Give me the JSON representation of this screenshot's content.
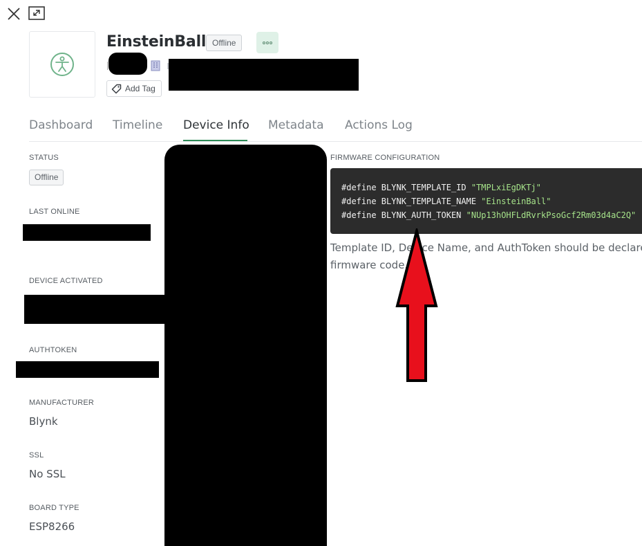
{
  "device": {
    "name": "EinsteinBall",
    "status": "Offline",
    "add_tag_label": "Add Tag"
  },
  "tabs": [
    {
      "label": "Dashboard",
      "active": false
    },
    {
      "label": "Timeline",
      "active": false
    },
    {
      "label": "Device Info",
      "active": true
    },
    {
      "label": "Metadata",
      "active": false
    },
    {
      "label": "Actions Log",
      "active": false
    }
  ],
  "info": {
    "status_label": "STATUS",
    "status_value": "Offline",
    "last_online_label": "LAST ONLINE",
    "device_activated_label": "DEVICE ACTIVATED",
    "authtoken_label": "AUTHTOKEN",
    "manufacturer_label": "MANUFACTURER",
    "manufacturer_value": "Blynk",
    "ssl_label": "SSL",
    "ssl_value": "No SSL",
    "board_type_label": "BOARD TYPE",
    "board_type_value": "ESP8266"
  },
  "firmware": {
    "section_label": "FIRMWARE CONFIGURATION",
    "lines": [
      {
        "keyword": "#define BLYNK_TEMPLATE_ID ",
        "value": "\"TMPLxiEgDKTj\""
      },
      {
        "keyword": "#define BLYNK_TEMPLATE_NAME ",
        "value": "\"EinsteinBall\""
      },
      {
        "keyword": "#define BLYNK_AUTH_TOKEN ",
        "value": "\"NUp13hOHFLdRvrkPsoGcf2Rm03d4aC2Q\""
      }
    ],
    "note_line1": "Template ID, Device Name, and AuthToken should be declared",
    "note_line2": "firmware code."
  },
  "icons": {
    "close": "close-icon",
    "expand": "expand-icon",
    "device": "accessibility-person-icon",
    "more": "more-dots-icon",
    "tag": "tag-icon",
    "org": "building-icon"
  },
  "colors": {
    "accent": "#2e8b57",
    "code_bg": "#2c2c2c",
    "code_string": "#a6e38a",
    "device_icon": "#6fb38a",
    "more_bg": "#dff1e7",
    "arrow": "#e8101c"
  }
}
